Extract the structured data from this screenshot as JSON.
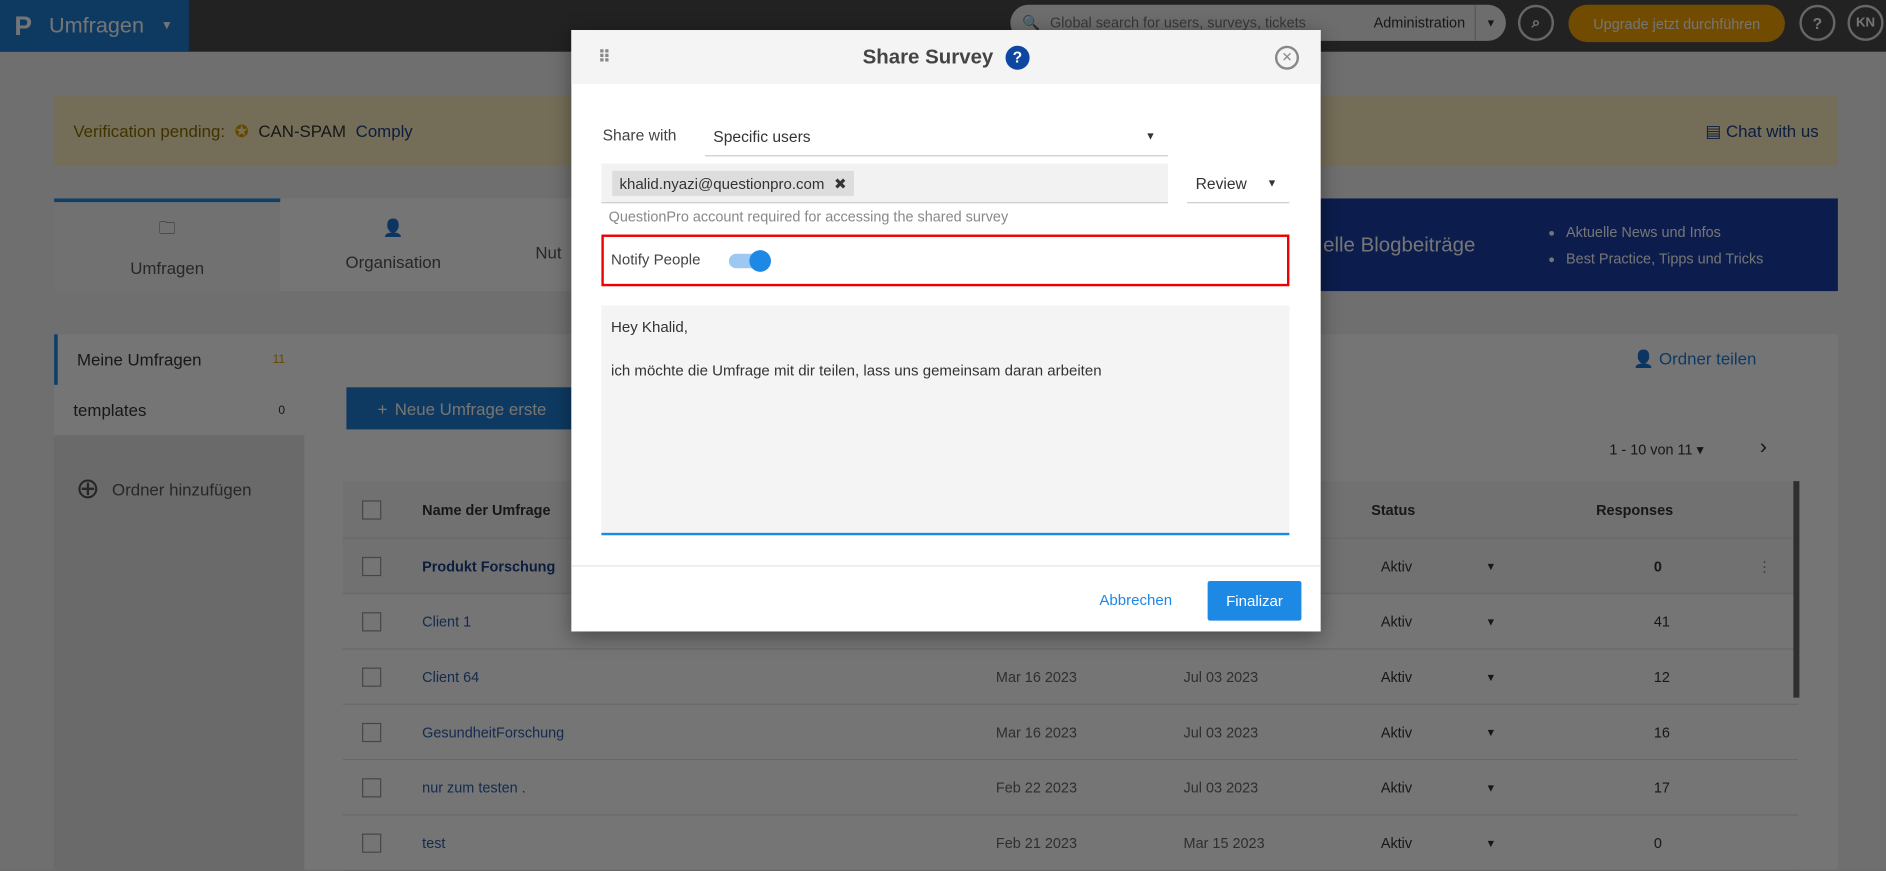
{
  "topbar": {
    "app": "Umfragen",
    "search_placeholder": "Global search for users, surveys, tickets",
    "account": "Administration",
    "upgrade": "Upgrade jetzt durchführen",
    "help": "?",
    "avatar": "KN"
  },
  "banner": {
    "label": "Verification pending:",
    "badge": "CAN-SPAM",
    "link": "Comply",
    "chat": "Chat with us"
  },
  "tabs": [
    {
      "label": "Umfragen"
    },
    {
      "label": "Organisation"
    },
    {
      "label": "Nut"
    }
  ],
  "blog": {
    "title": "elle Blogbeiträge",
    "bullets": [
      "Aktuelle News und Infos",
      "Best Practice, Tipps und Tricks"
    ]
  },
  "sidebar": {
    "items": [
      {
        "label": "Meine Umfragen",
        "count": "11"
      },
      {
        "label": "templates",
        "count": "0"
      }
    ],
    "add_folder": "Ordner hinzufügen"
  },
  "main": {
    "new_button": "Neue Umfrage erste",
    "share_folder": "Ordner teilen",
    "pagination": "1 - 10 von 11",
    "headers": {
      "name": "Name der Umfrage",
      "status": "Status",
      "responses": "Responses"
    },
    "rows": [
      {
        "name": "Produkt Forschung",
        "created": "",
        "modified": "",
        "status": "Aktiv",
        "responses": "0"
      },
      {
        "name": "Client 1",
        "created": "",
        "modified": "",
        "status": "Aktiv",
        "responses": "41"
      },
      {
        "name": "Client 64",
        "created": "Mar 16 2023",
        "modified": "Jul 03 2023",
        "status": "Aktiv",
        "responses": "12"
      },
      {
        "name": "GesundheitForschung",
        "created": "Mar 16 2023",
        "modified": "Jul 03 2023",
        "status": "Aktiv",
        "responses": "16"
      },
      {
        "name": "nur zum testen .",
        "created": "Feb 22 2023",
        "modified": "Jul 03 2023",
        "status": "Aktiv",
        "responses": "17"
      },
      {
        "name": "test",
        "created": "Feb 21 2023",
        "modified": "Mar 15 2023",
        "status": "Aktiv",
        "responses": "0"
      }
    ]
  },
  "dialog": {
    "title": "Share Survey",
    "share_with_label": "Share with",
    "share_with_value": "Specific users",
    "chip": "khalid.nyazi@questionpro.com",
    "permission": "Review",
    "hint": "QuestionPro account required for accessing the shared survey",
    "notify_label": "Notify People",
    "notify_on": true,
    "message_line1": "Hey Khalid,",
    "message_line2": "ich möchte die Umfrage mit dir teilen, lass uns gemeinsam daran arbeiten",
    "cancel": "Abbrechen",
    "submit": "Finalizar"
  }
}
